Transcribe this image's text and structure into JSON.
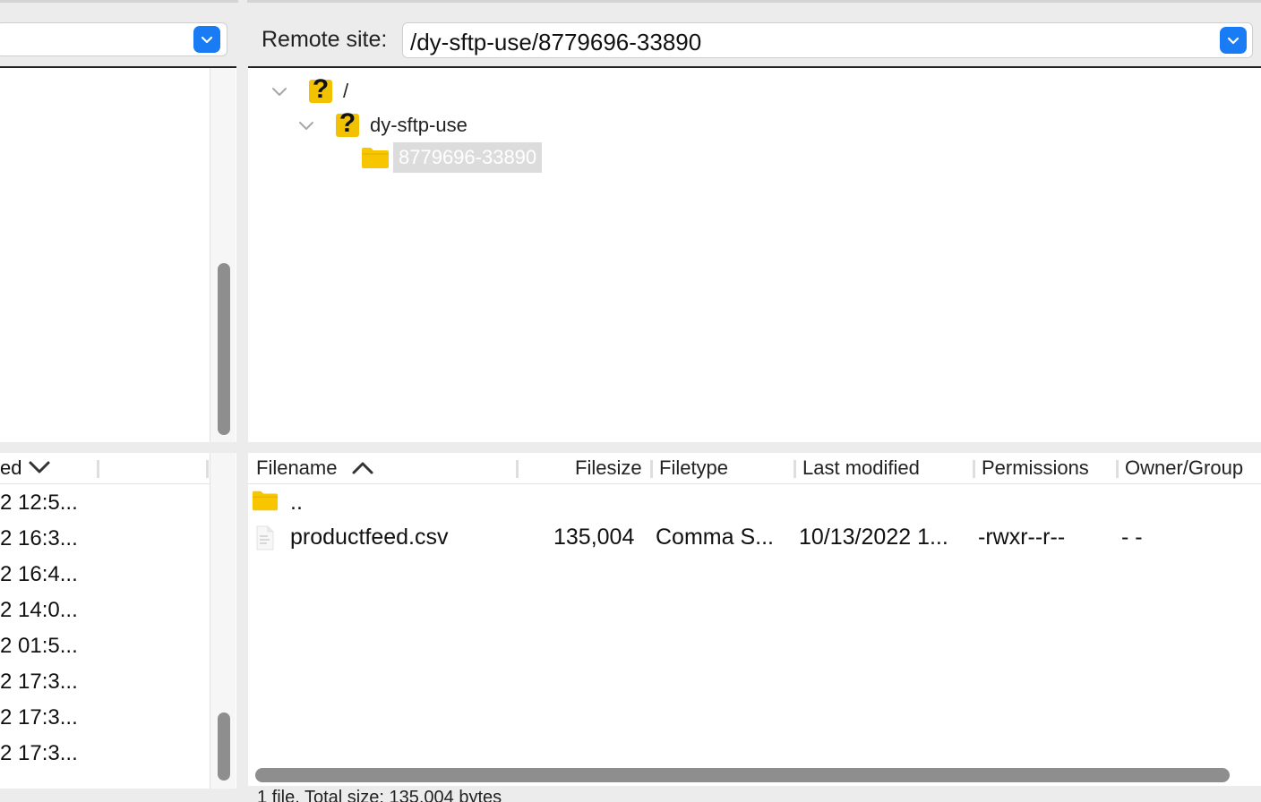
{
  "remote_site": {
    "label": "Remote site:",
    "path": "/dy-sftp-use/8779696-33890"
  },
  "remote_tree": [
    {
      "label": "/",
      "icon": "unknown-folder-icon",
      "expanded": true
    },
    {
      "label": "dy-sftp-use",
      "icon": "unknown-folder-icon",
      "expanded": true
    },
    {
      "label": "8779696-33890",
      "icon": "folder-icon",
      "selected": true
    }
  ],
  "local_list": {
    "header": "ed",
    "rows": [
      "2 12:5...",
      "2 16:3...",
      "2 16:4...",
      "2 14:0...",
      "2 01:5...",
      "2 17:3...",
      "2 17:3...",
      "2 17:3..."
    ]
  },
  "remote_list": {
    "columns": {
      "filename": "Filename",
      "filesize": "Filesize",
      "filetype": "Filetype",
      "last_modified": "Last modified",
      "permissions": "Permissions",
      "owner_group": "Owner/Group"
    },
    "parent_dir": "..",
    "files": [
      {
        "name": "productfeed.csv",
        "size": "135,004",
        "type": "Comma S...",
        "modified": "10/13/2022 1...",
        "permissions": "-rwxr--r--",
        "owner": "- -"
      }
    ]
  },
  "status": {
    "text": "1 file. Total size: 135,004 bytes"
  },
  "colors": {
    "accent": "#1a7cf5",
    "folder": "#f7c600",
    "selection": "#dcdcdc"
  }
}
